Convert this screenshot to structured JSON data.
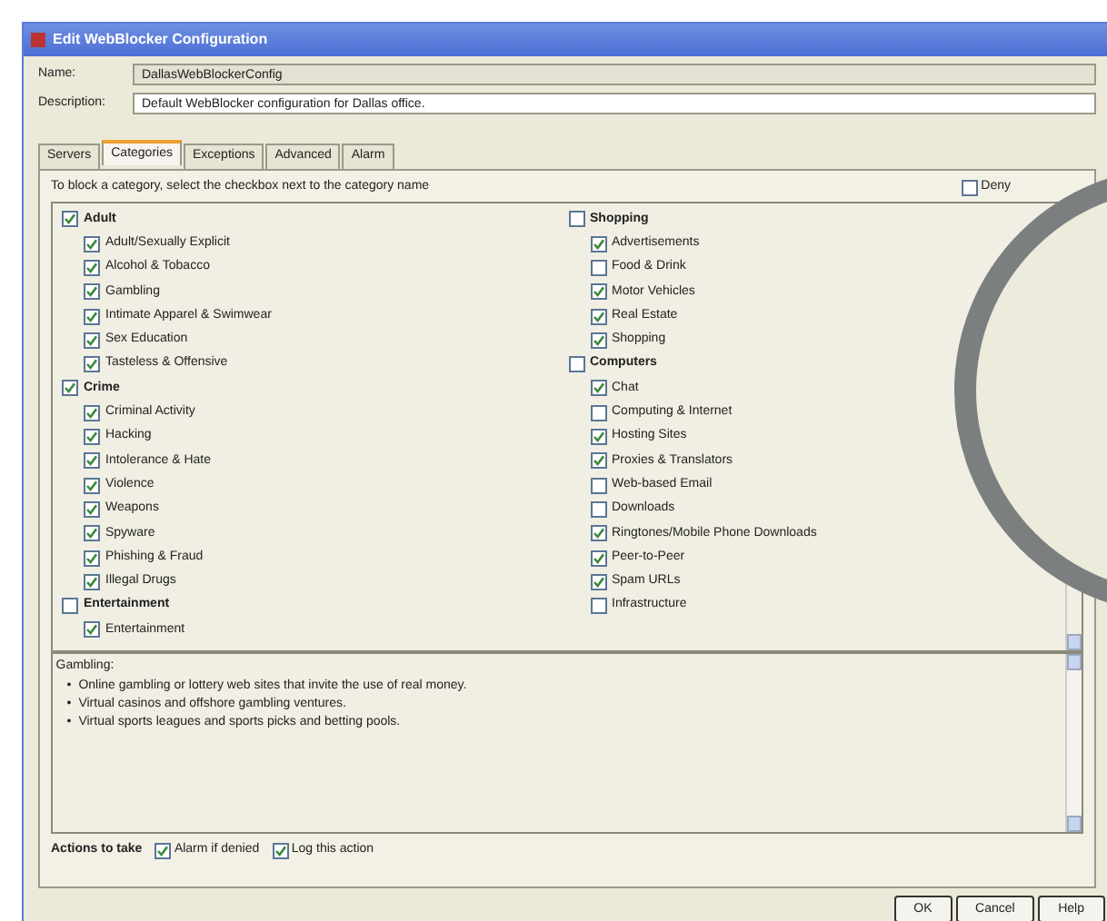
{
  "window": {
    "title": "Edit WebBlocker Configuration"
  },
  "fields": [
    {
      "label": "Name:",
      "value": "DallasWebBlockerConfig",
      "editable": false
    },
    {
      "label": "Description:",
      "value": "Default WebBlocker configuration for Dallas office.",
      "editable": true
    }
  ],
  "tabs": [
    {
      "label": "Servers",
      "selected": false
    },
    {
      "label": "Categories",
      "selected": true
    },
    {
      "label": "Exceptions",
      "selected": false
    },
    {
      "label": "Advanced",
      "selected": false
    },
    {
      "label": "Alarm",
      "selected": false
    }
  ],
  "instruction": "To block a category, select the checkbox next to the category name",
  "deny": {
    "label": "Deny",
    "checked": false
  },
  "category_columns": [
    [
      {
        "label": "Adult",
        "checked": true,
        "children": [
          {
            "label": "Adult/Sexually Explicit",
            "checked": true
          },
          {
            "label": "Alcohol & Tobacco",
            "checked": true
          },
          {
            "label": "Gambling",
            "checked": true
          },
          {
            "label": "Intimate Apparel & Swimwear",
            "checked": true
          },
          {
            "label": "Sex Education",
            "checked": true
          },
          {
            "label": "Tasteless & Offensive",
            "checked": true
          }
        ]
      },
      {
        "label": "Crime",
        "checked": true,
        "children": [
          {
            "label": "Criminal Activity",
            "checked": true
          },
          {
            "label": "Hacking",
            "checked": true
          },
          {
            "label": "Intolerance & Hate",
            "checked": true
          },
          {
            "label": "Violence",
            "checked": true
          },
          {
            "label": "Weapons",
            "checked": true
          },
          {
            "label": "Spyware",
            "checked": true
          },
          {
            "label": "Phishing & Fraud",
            "checked": true
          },
          {
            "label": "Illegal Drugs",
            "checked": true
          }
        ]
      },
      {
        "label": "Entertainment",
        "checked": false,
        "children": [
          {
            "label": "Entertainment",
            "checked": true
          }
        ]
      }
    ],
    [
      {
        "label": "Shopping",
        "checked": false,
        "children": [
          {
            "label": "Advertisements",
            "checked": true
          },
          {
            "label": "Food & Drink",
            "checked": false
          },
          {
            "label": "Motor Vehicles",
            "checked": true
          },
          {
            "label": "Real Estate",
            "checked": true
          },
          {
            "label": "Shopping",
            "checked": true
          }
        ]
      },
      {
        "label": "Computers",
        "checked": false,
        "children": [
          {
            "label": "Chat",
            "checked": true
          },
          {
            "label": "Computing & Internet",
            "checked": false
          },
          {
            "label": "Hosting Sites",
            "checked": true
          },
          {
            "label": "Proxies & Translators",
            "checked": true
          },
          {
            "label": "Web-based Email",
            "checked": false
          },
          {
            "label": "Downloads",
            "checked": false
          },
          {
            "label": "Ringtones/Mobile Phone Downloads",
            "checked": true
          },
          {
            "label": "Peer-to-Peer",
            "checked": true
          },
          {
            "label": "Spam URLs",
            "checked": true
          },
          {
            "label": "Infrastructure",
            "checked": false
          }
        ]
      }
    ]
  ],
  "details": {
    "title": "Gambling:",
    "marker": "•",
    "bullets": [
      "Online gambling or lottery web sites that invite the use of real money.",
      "Virtual casinos and offshore gambling ventures.",
      "Virtual sports leagues and sports picks and betting pools."
    ]
  },
  "actions": {
    "label": "Actions to take",
    "options": [
      {
        "label": "Alarm if denied",
        "checked": true
      },
      {
        "label": "Log this action",
        "checked": true
      }
    ]
  },
  "buttons": [
    "OK",
    "Cancel",
    "Help"
  ]
}
